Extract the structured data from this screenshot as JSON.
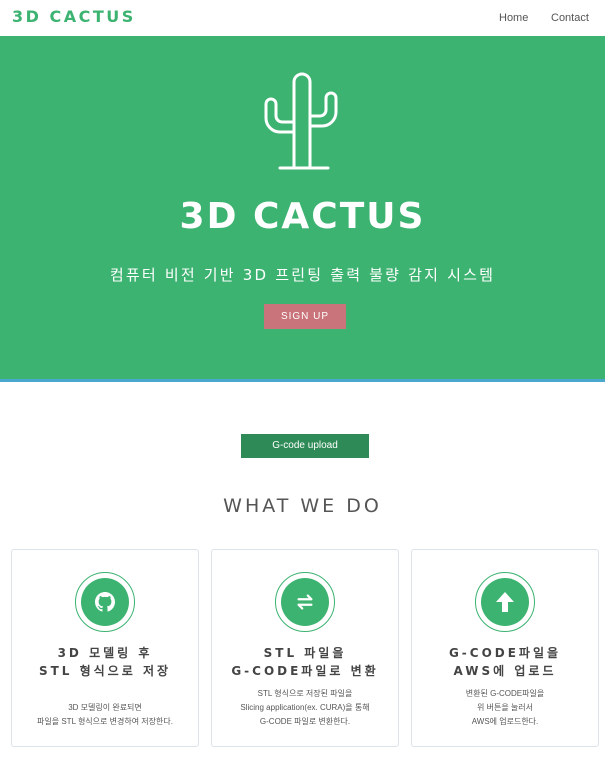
{
  "nav": {
    "brand": "3D CACTUS",
    "home": "Home",
    "contact": "Contact"
  },
  "hero": {
    "title": "3D CACTUS",
    "subtitle": "컴퓨터 비전 기반 3D 프린팅 출력 불량 감지 시스템",
    "signup": "SIGN UP",
    "logo_icon": "cactus-icon"
  },
  "upload": {
    "label": "G-code upload"
  },
  "section": {
    "title": "WHAT WE DO"
  },
  "cards": [
    {
      "icon": "github-icon",
      "title_lines": [
        "3D 모델링 후",
        "STL 형식으로 저장"
      ],
      "desc_lines": [
        "3D 모델링이 완료되면",
        "파일을 STL 형식으로 변경하여 저장한다."
      ]
    },
    {
      "icon": "exchange-icon",
      "title_lines": [
        "STL 파일을",
        "G-CODE파일로 변환"
      ],
      "desc_lines": [
        "STL 형식으로 저장된 파일을",
        "Slicing application(ex. CURA)을 통해",
        "G-CODE 파일로 변환한다."
      ]
    },
    {
      "icon": "upload-arrow-icon",
      "title_lines": [
        "G-CODE파일을",
        "AWS에 업로드"
      ],
      "desc_lines": [
        "변환된 G-CODE파일을",
        "위 버튼을 눌러서",
        "AWS에 업로드한다."
      ]
    }
  ],
  "colors": {
    "primary": "#3cb371",
    "signup": "#c9737a",
    "upload": "#2e8b57",
    "hero_border": "#4aa8cf"
  }
}
